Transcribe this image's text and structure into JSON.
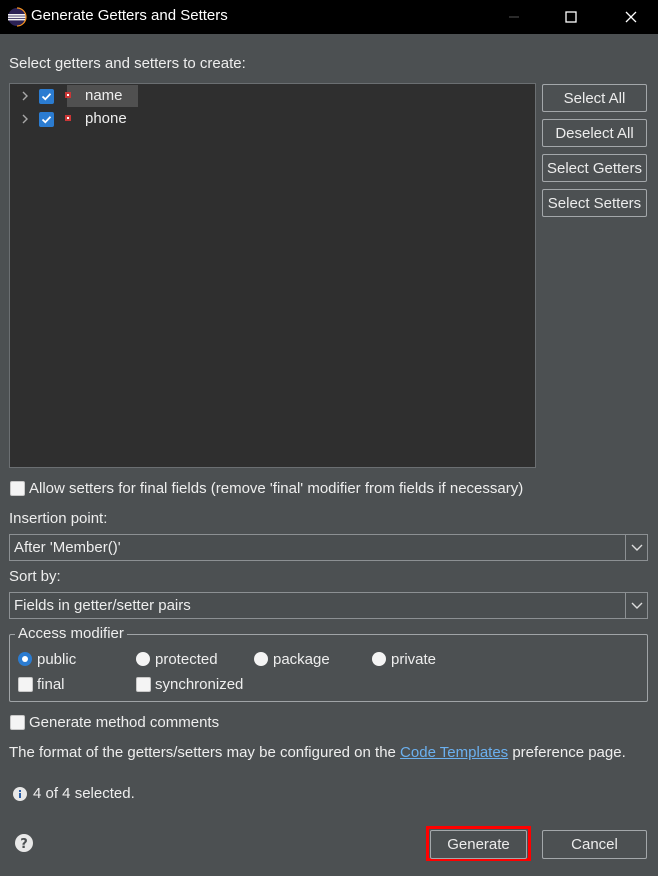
{
  "window": {
    "title": "Generate Getters and Setters",
    "controls": [
      "minimize-icon",
      "maximize-icon",
      "close-icon"
    ]
  },
  "prompt_label": "Select getters and setters to create:",
  "tree": {
    "items": [
      {
        "label": "name",
        "checked": true,
        "expanded": false,
        "selected": true
      },
      {
        "label": "phone",
        "checked": true,
        "expanded": false,
        "selected": false
      }
    ]
  },
  "side_buttons": {
    "select_all": "Select All",
    "deselect_all": "Deselect All",
    "select_getters": "Select Getters",
    "select_setters": "Select Setters"
  },
  "allow_setters_final": {
    "label": "Allow setters for final fields (remove 'final' modifier from fields if necessary)",
    "checked": false
  },
  "insertion_point": {
    "label": "Insertion point:",
    "value": "After 'Member()'"
  },
  "sort_by": {
    "label": "Sort by:",
    "value": "Fields in getter/setter pairs"
  },
  "access_modifier": {
    "legend": "Access modifier",
    "options": [
      "public",
      "protected",
      "package",
      "private"
    ],
    "selected": "public",
    "final_label": "final",
    "final_checked": false,
    "synchronized_label": "synchronized",
    "synchronized_checked": false
  },
  "generate_comments": {
    "label": "Generate method comments",
    "checked": false
  },
  "format_note": {
    "prefix": "The format of the getters/setters may be configured on the ",
    "link": "Code Templates",
    "suffix": " preference page."
  },
  "status": {
    "icon": "info-icon",
    "text": "4 of 4 selected."
  },
  "footer": {
    "help_icon": "help-icon",
    "generate_label": "Generate",
    "cancel_label": "Cancel"
  },
  "colors": {
    "background": "#4c5052",
    "tree_background": "#2f2f2f",
    "accent": "#2b7cd1",
    "link": "#6bb0ef",
    "highlight_outline": "#ff0000"
  }
}
